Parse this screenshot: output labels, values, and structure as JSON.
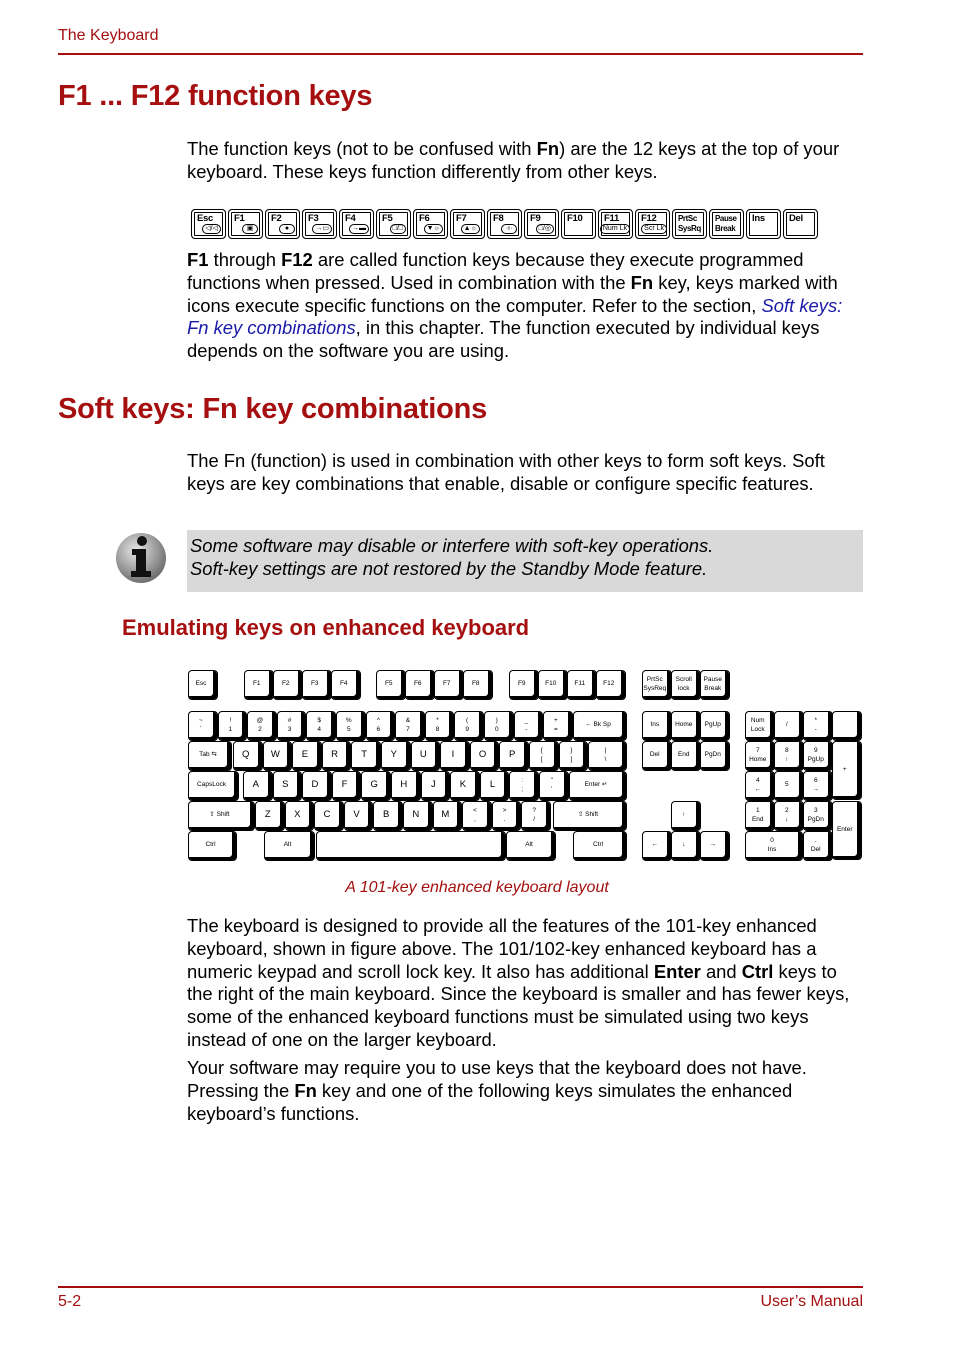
{
  "header": {
    "section": "The Keyboard"
  },
  "section1": {
    "title": "F1 ... F12 function keys",
    "intro": {
      "p1": "The function keys (not to be confused with ",
      "b1": "Fn",
      "p2": ") are the 12 keys at the top of your keyboard. These keys function differently from other keys."
    },
    "fkeys": [
      {
        "label": "Esc",
        "icon": "mute-speaker-icon"
      },
      {
        "label": "F1",
        "icon": "lock-icon"
      },
      {
        "label": "F2",
        "icon": "power-plan-icon"
      },
      {
        "label": "F3",
        "icon": "sleep-icon"
      },
      {
        "label": "F4",
        "icon": "hibernate-icon"
      },
      {
        "label": "F5",
        "icon": "display-switch-icon"
      },
      {
        "label": "F6",
        "icon": "brightness-down-icon"
      },
      {
        "label": "F7",
        "icon": "brightness-up-icon"
      },
      {
        "label": "F8",
        "icon": "wireless-icon"
      },
      {
        "label": "F9",
        "icon": "touchpad-icon"
      },
      {
        "label": "F10",
        "icon": ""
      },
      {
        "label": "F11",
        "sub": "Num Lk"
      },
      {
        "label": "F12",
        "sub": "Scr Lk"
      },
      {
        "label": "PrtSc",
        "label2": "SysRq"
      },
      {
        "label": "Pause",
        "label2": "Break"
      },
      {
        "label": "Ins"
      },
      {
        "label": "Del"
      }
    ],
    "body": {
      "b1": "F1",
      "t1": " through ",
      "b2": "F12",
      "t2": " are called function keys because they execute programmed functions when pressed. Used in combination with the ",
      "b3": "Fn",
      "t3": " key, keys marked with icons execute specific functions on the computer. Refer to the section, ",
      "link": "Soft keys: Fn key combinations",
      "t4": ", in this chapter. The function executed by individual keys depends on the software you are using."
    }
  },
  "section2": {
    "title": "Soft keys: Fn key combinations",
    "intro": "The Fn (function) is used in combination with other keys to form soft keys. Soft keys are key combinations that enable, disable or configure specific features.",
    "note": {
      "line1": "Some software may disable or interfere with soft-key operations.",
      "line2": "Soft-key settings are not restored by the Standby Mode feature."
    }
  },
  "section3": {
    "title": "Emulating keys on enhanced keyboard",
    "figure_caption": "A 101-key enhanced keyboard layout",
    "keys": [
      [
        "Esc"
      ],
      [
        "F1"
      ],
      [
        "F2"
      ],
      [
        "F3"
      ],
      [
        "F4"
      ],
      [
        "F5"
      ],
      [
        "F6"
      ],
      [
        "F7"
      ],
      [
        "F8"
      ],
      [
        "F9"
      ],
      [
        "F10"
      ],
      [
        "F11"
      ],
      [
        "F12"
      ],
      [
        "PrtSc",
        "SysReq"
      ],
      [
        "Scroll",
        "lock"
      ],
      [
        "Pause",
        "Break"
      ],
      [
        "~",
        "`"
      ],
      [
        "!",
        "1"
      ],
      [
        "@",
        "2"
      ],
      [
        "#",
        "3"
      ],
      [
        "$",
        "4"
      ],
      [
        "%",
        "5"
      ],
      [
        "^",
        "6"
      ],
      [
        "&",
        "7"
      ],
      [
        "*",
        "8"
      ],
      [
        "(",
        "9"
      ],
      [
        ")",
        "0"
      ],
      [
        "_",
        "-"
      ],
      [
        "+",
        "="
      ],
      [
        "←  Bk Sp"
      ],
      [
        "Ins"
      ],
      [
        "Home"
      ],
      [
        "PgUp"
      ],
      [
        "Num",
        "Lock"
      ],
      [
        "/"
      ],
      [
        "*",
        "-"
      ],
      [
        ""
      ],
      [
        "Tab ⇆"
      ],
      [
        "Q"
      ],
      [
        "W"
      ],
      [
        "E"
      ],
      [
        "R"
      ],
      [
        "T"
      ],
      [
        "Y"
      ],
      [
        "U"
      ],
      [
        "I"
      ],
      [
        "O"
      ],
      [
        "P"
      ],
      [
        "{",
        "["
      ],
      [
        "}",
        "]"
      ],
      [
        "|",
        "\\"
      ],
      [
        "Del"
      ],
      [
        "End"
      ],
      [
        "PgDn"
      ],
      [
        "7",
        "Home"
      ],
      [
        "8",
        "↑"
      ],
      [
        "9",
        "PgUp"
      ],
      [
        "+"
      ],
      [
        "CapsLock"
      ],
      [
        "A"
      ],
      [
        "S"
      ],
      [
        "D"
      ],
      [
        "F"
      ],
      [
        "G"
      ],
      [
        "H"
      ],
      [
        "J"
      ],
      [
        "K"
      ],
      [
        "L"
      ],
      [
        ":",
        ";"
      ],
      [
        "\"",
        "'"
      ],
      [
        "Enter ↵"
      ],
      [
        "4",
        "←"
      ],
      [
        "5"
      ],
      [
        "6",
        "→"
      ],
      [
        "⇧ Shift"
      ],
      [
        "Z"
      ],
      [
        "X"
      ],
      [
        "C"
      ],
      [
        "V"
      ],
      [
        "B"
      ],
      [
        "N"
      ],
      [
        "M"
      ],
      [
        "<",
        ","
      ],
      [
        ">",
        "."
      ],
      [
        "?",
        "/"
      ],
      [
        "⇧ Shift"
      ],
      [
        "↑"
      ],
      [
        "1",
        "End"
      ],
      [
        "2",
        "↓"
      ],
      [
        "3",
        "PgDn"
      ],
      [
        "Enter"
      ],
      [
        "Ctrl"
      ],
      [
        "Alt"
      ],
      [
        ""
      ],
      [
        "Alt"
      ],
      [
        "Ctrl"
      ],
      [
        "←"
      ],
      [
        "↓"
      ],
      [
        "→"
      ],
      [
        "0",
        "Ins"
      ],
      [
        ".",
        "Del"
      ]
    ],
    "body1": {
      "t1": "The keyboard is designed to provide all the features of the 101-key enhanced keyboard, shown in figure above. The 101/102-key enhanced keyboard has a numeric keypad and scroll lock key. It also has additional ",
      "b1": "Enter",
      "t2": " and ",
      "b2": "Ctrl",
      "t3": " keys to the right of the main keyboard. Since the keyboard is smaller and has fewer keys, some of the enhanced keyboard functions must be simulated using two keys instead of one on the larger keyboard."
    },
    "body2": {
      "t1": "Your software may require you to use keys that the keyboard does not have. Pressing the ",
      "b1": "Fn",
      "t2": " key and one of the following keys simulates the enhanced keyboard’s functions."
    }
  },
  "footer": {
    "page": "5-2",
    "title": "User’s Manual"
  }
}
